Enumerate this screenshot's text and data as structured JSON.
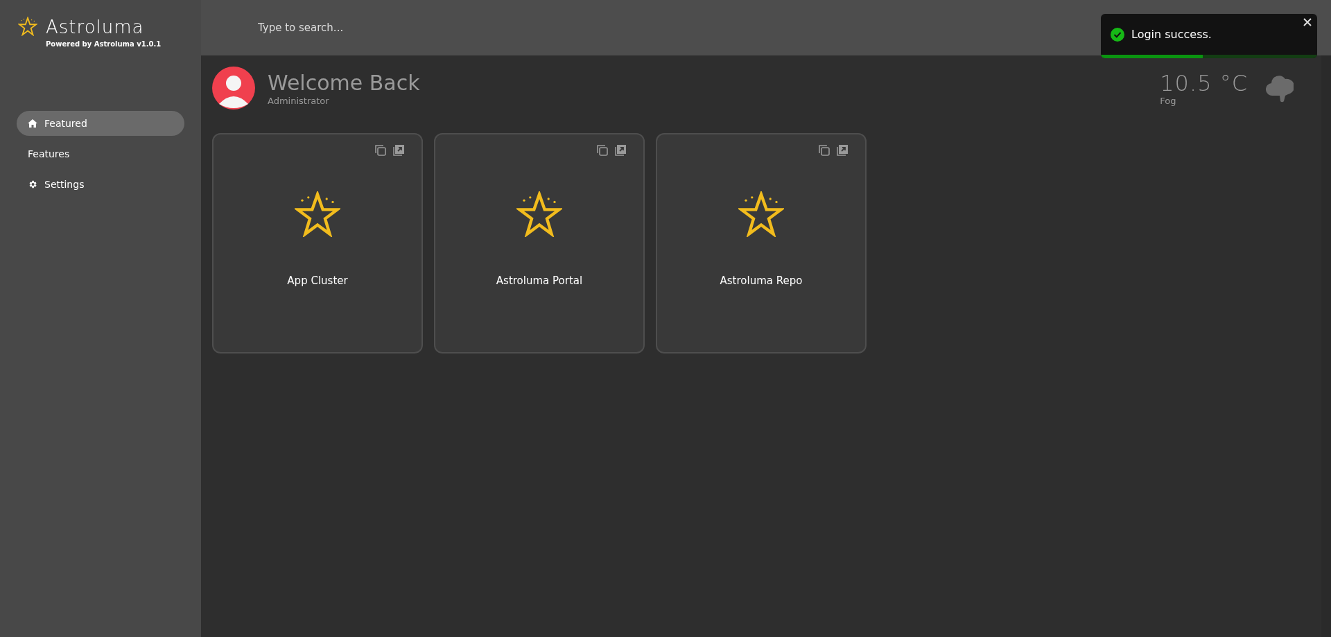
{
  "brand": {
    "name": "Astroluma",
    "tagline": "Powered by Astroluma v1.0.1"
  },
  "search": {
    "placeholder": "Type to search..."
  },
  "sidebar": {
    "items": [
      {
        "label": "Featured",
        "kind": "home",
        "selected": true
      },
      {
        "label": "Features",
        "kind": "plain",
        "selected": false
      },
      {
        "label": "Settings",
        "kind": "gear",
        "selected": false
      }
    ]
  },
  "welcome": {
    "title": "Welcome Back",
    "subtitle": "Administrator"
  },
  "weather": {
    "temperature": "10.5 °C",
    "condition": "Fog"
  },
  "cards": [
    {
      "title": "App Cluster"
    },
    {
      "title": "Astroluma Portal"
    },
    {
      "title": "Astroluma Repo"
    }
  ],
  "toast": {
    "message": "Login success.",
    "level": 0.47
  }
}
